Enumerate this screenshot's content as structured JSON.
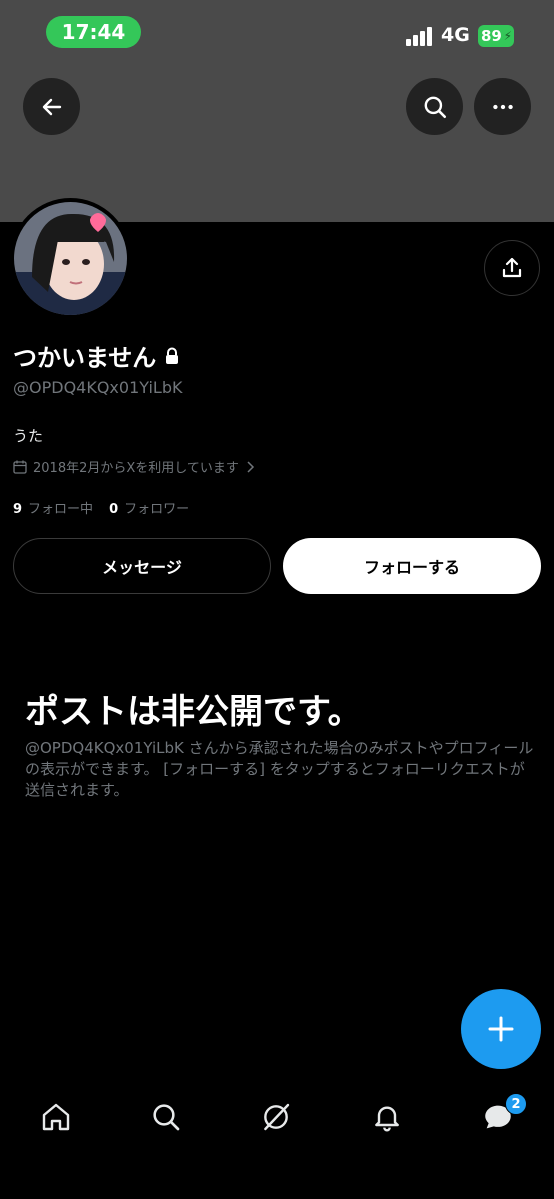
{
  "status_bar": {
    "time": "17:44",
    "network": "4G",
    "battery": "89"
  },
  "profile": {
    "display_name": "つかいません",
    "handle": "@OPDQ4KQx01YiLbK",
    "bio": "うた",
    "joined": "2018年2月からXを利用しています",
    "following_count": "9",
    "following_label": "フォロー中",
    "followers_count": "0",
    "followers_label": "フォロワー"
  },
  "actions": {
    "message_label": "メッセージ",
    "follow_label": "フォローする"
  },
  "private_notice": {
    "heading": "ポストは非公開です。",
    "description": "@OPDQ4KQx01YiLbK さんから承認された場合のみポストやプロフィールの表示ができます。 [フォローする] をタップするとフォローリクエストが送信されます。"
  },
  "tab_bar": {
    "messages_badge": "2"
  },
  "colors": {
    "accent": "#1d9bf0",
    "status_green": "#34c759",
    "banner": "#4a4a4a"
  }
}
